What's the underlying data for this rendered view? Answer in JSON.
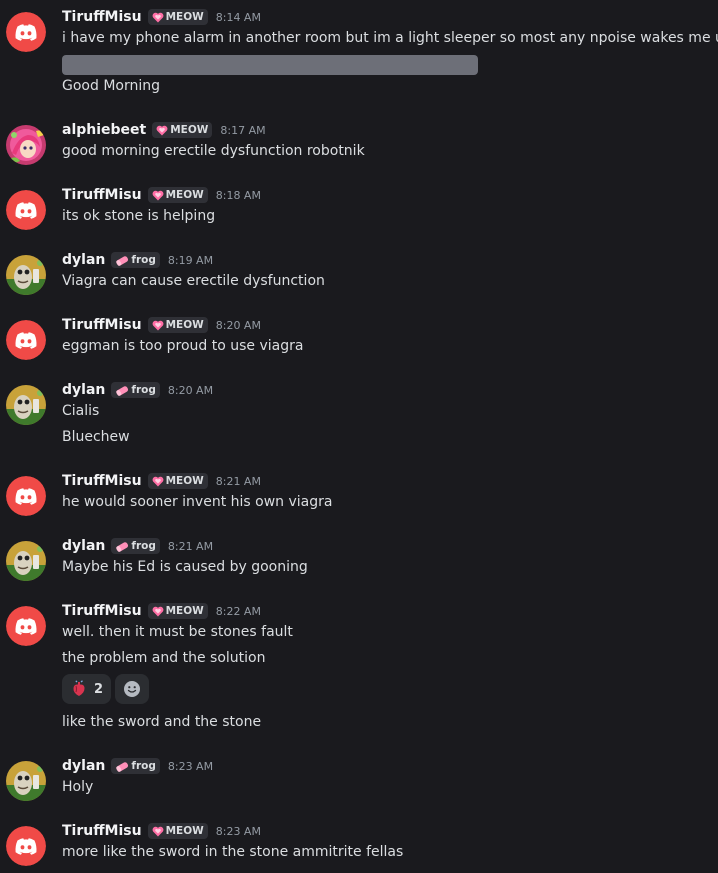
{
  "colors": {
    "discord_red": "#f04a47",
    "background": "#1a1a1e",
    "username": "#f2f3f5",
    "timestamp": "#949ba4",
    "spoiler": "#6d6f78"
  },
  "messages": [
    {
      "author": "TiruffMisu",
      "avatar": "discord-logo-icon",
      "tag": {
        "icon": "heart-icon",
        "text": "MEOW"
      },
      "time": "8:14 AM",
      "lines": [
        "i have my phone alarm in another room but im a light sleeper so most any npoise wakes me up",
        "Good Morning"
      ],
      "spoiler": true
    },
    {
      "author": "alphiebeet",
      "avatar": "anime-avatar",
      "tag": {
        "icon": "heart-icon",
        "text": "MEOW"
      },
      "time": "8:17 AM",
      "lines": [
        "good morning erectile dysfunction robotnik"
      ]
    },
    {
      "author": "TiruffMisu",
      "avatar": "discord-logo-icon",
      "tag": {
        "icon": "heart-icon",
        "text": "MEOW"
      },
      "time": "8:18 AM",
      "lines": [
        "its ok stone is helping"
      ]
    },
    {
      "author": "dylan",
      "avatar": "frog-avatar",
      "tag": {
        "icon": "eraser-icon",
        "text": "frog"
      },
      "time": "8:19 AM",
      "lines": [
        "Viagra can cause erectile dysfunction"
      ]
    },
    {
      "author": "TiruffMisu",
      "avatar": "discord-logo-icon",
      "tag": {
        "icon": "heart-icon",
        "text": "MEOW"
      },
      "time": "8:20 AM",
      "lines": [
        "eggman is too proud to use viagra"
      ]
    },
    {
      "author": "dylan",
      "avatar": "frog-avatar",
      "tag": {
        "icon": "eraser-icon",
        "text": "frog"
      },
      "time": "8:20 AM",
      "lines": [
        "Cialis",
        "Bluechew"
      ]
    },
    {
      "author": "TiruffMisu",
      "avatar": "discord-logo-icon",
      "tag": {
        "icon": "heart-icon",
        "text": "MEOW"
      },
      "time": "8:21 AM",
      "lines": [
        "he would sooner invent his own viagra"
      ]
    },
    {
      "author": "dylan",
      "avatar": "frog-avatar",
      "tag": {
        "icon": "eraser-icon",
        "text": "frog"
      },
      "time": "8:21 AM",
      "lines": [
        "Maybe his Ed is caused by gooning"
      ]
    },
    {
      "author": "TiruffMisu",
      "avatar": "discord-logo-icon",
      "tag": {
        "icon": "heart-icon",
        "text": "MEOW"
      },
      "time": "8:22 AM",
      "lines": [
        "well. then it must be stones fault",
        "the problem and the solution",
        "like the sword and the stone"
      ],
      "reaction": {
        "emoji": "anatomical-heart-icon",
        "count": "2"
      }
    },
    {
      "author": "dylan",
      "avatar": "frog-avatar",
      "tag": {
        "icon": "eraser-icon",
        "text": "frog"
      },
      "time": "8:23 AM",
      "lines": [
        "Holy"
      ]
    },
    {
      "author": "TiruffMisu",
      "avatar": "discord-logo-icon",
      "tag": {
        "icon": "heart-icon",
        "text": "MEOW"
      },
      "time": "8:23 AM",
      "lines": [
        "more like the sword in the stone ammitrite fellas"
      ]
    }
  ]
}
